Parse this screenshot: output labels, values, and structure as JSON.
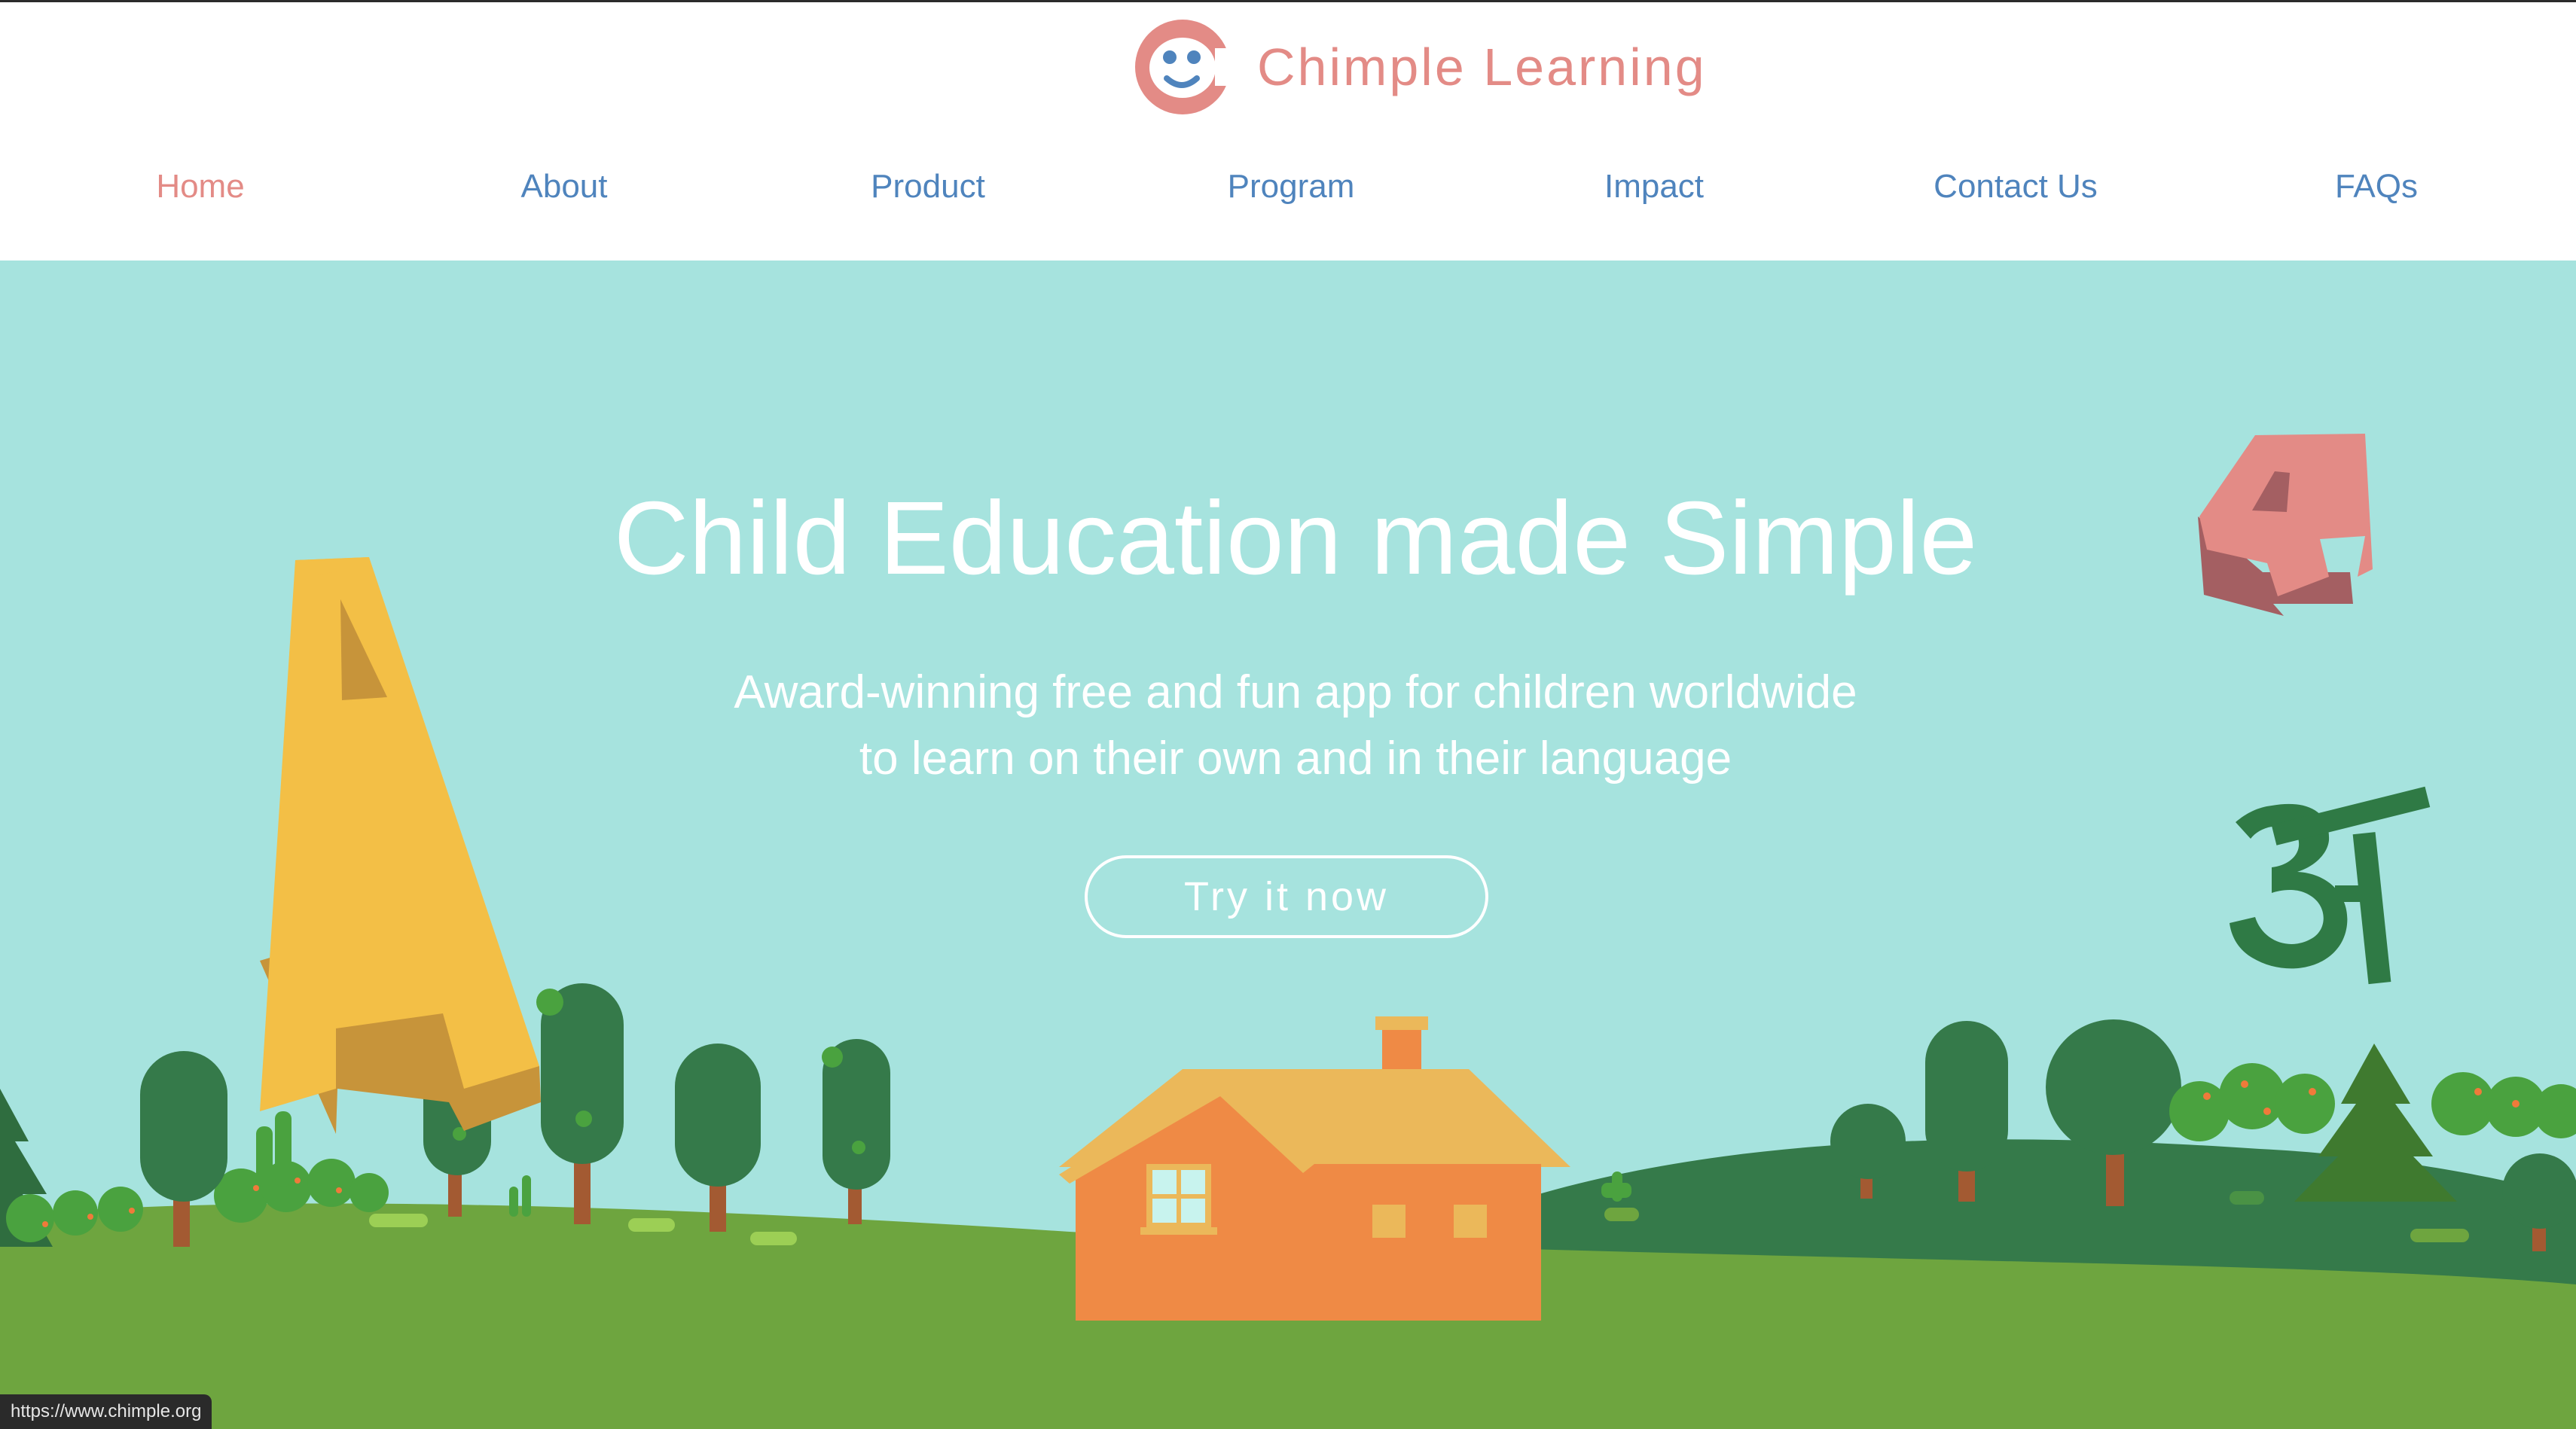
{
  "brand": {
    "name": "Chimple Learning",
    "logo_icon": "monkey-face-logo"
  },
  "nav": {
    "items": [
      {
        "label": "Home",
        "active": true
      },
      {
        "label": "About",
        "active": false
      },
      {
        "label": "Product",
        "active": false
      },
      {
        "label": "Program",
        "active": false
      },
      {
        "label": "Impact",
        "active": false
      },
      {
        "label": "Contact Us",
        "active": false
      },
      {
        "label": "FAQs",
        "active": false
      }
    ]
  },
  "hero": {
    "title": "Child Education made Simple",
    "subtitle_line1": "Award-winning free and fun app for children worldwide",
    "subtitle_line2": "to learn on their own and in their language",
    "cta_label": "Try it now",
    "floating_glyphs": {
      "letter_a": "A",
      "digit_four": "4",
      "hindi_a": "अ"
    }
  },
  "status_bar": {
    "url": "https://www.chimple.org"
  },
  "colors": {
    "brand_pink": "#e38b86",
    "nav_blue": "#4f84bd",
    "sky": "#a6e3de",
    "grass": "#6ea53f",
    "dark_hill": "#357a4a",
    "house": "#ef8a45",
    "roof": "#ebb85a"
  }
}
